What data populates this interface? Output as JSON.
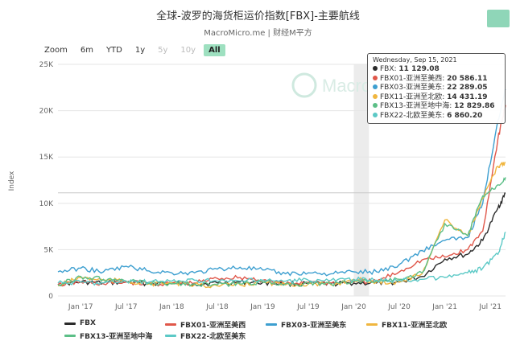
{
  "header": {
    "title": "全球-波罗的海货柜运价指数[FBX]-主要航线",
    "subtitle": "MacroMicro.me | 财经M平方"
  },
  "zoom": {
    "label": "Zoom",
    "buttons": [
      {
        "label": "6m",
        "state": "normal"
      },
      {
        "label": "YTD",
        "state": "normal"
      },
      {
        "label": "1y",
        "state": "normal"
      },
      {
        "label": "5y",
        "state": "disabled"
      },
      {
        "label": "10y",
        "state": "disabled"
      },
      {
        "label": "All",
        "state": "active"
      }
    ]
  },
  "watermark": "MacroM",
  "tooltip": {
    "date": "Wednesday, Sep 15, 2021",
    "rows": [
      {
        "label": "FBX: ",
        "value": "11 129.08",
        "color": "#2b2b2b"
      },
      {
        "label": "FBX01-亚洲至美西: ",
        "value": "20 586.11",
        "color": "#e0574a"
      },
      {
        "label": "FBX03-亚洲至美东: ",
        "value": "22 289.05",
        "color": "#3d9fd0"
      },
      {
        "label": "FBX11-亚洲至北欧: ",
        "value": "14 431.19",
        "color": "#f0b63f"
      },
      {
        "label": "FBX13-亚洲至地中海: ",
        "value": "12 829.86",
        "color": "#5cbf87"
      },
      {
        "label": "FBX22-北欧至美东: ",
        "value": "6 860.20",
        "color": "#5cc9c6"
      }
    ]
  },
  "chart_data": {
    "type": "line",
    "ylabel": "Index",
    "ylim": [
      0,
      25000
    ],
    "yticks": [
      "0",
      "5K",
      "10K",
      "15K",
      "20K",
      "25K"
    ],
    "x_tick_labels": [
      "Jan '17",
      "Jul '17",
      "Jan '18",
      "Jul '18",
      "Jan '19",
      "Jul '19",
      "Jan '20",
      "Jul '20",
      "Jan '21",
      "Jul '21"
    ],
    "x_range": [
      "2016-10",
      "2021-09"
    ],
    "grid": true,
    "legend_position": "bottom",
    "plot_bands": [
      {
        "from": "2020-01",
        "to": "2020-03"
      }
    ],
    "plot_lines": [
      {
        "y": 11129.08
      }
    ],
    "series": [
      {
        "name": "FBX",
        "color": "#2b2b2b",
        "x": [
          "2016-10",
          "2017-01",
          "2017-04",
          "2017-07",
          "2017-10",
          "2018-01",
          "2018-04",
          "2018-07",
          "2018-10",
          "2019-01",
          "2019-04",
          "2019-07",
          "2019-10",
          "2020-01",
          "2020-04",
          "2020-07",
          "2020-10",
          "2021-01",
          "2021-04",
          "2021-06",
          "2021-08",
          "2021-09"
        ],
        "y": [
          1300,
          1500,
          1400,
          1500,
          1350,
          1400,
          1300,
          1400,
          1500,
          1450,
          1300,
          1350,
          1300,
          1400,
          1400,
          1500,
          2100,
          4000,
          4500,
          6000,
          9500,
          11100
        ]
      },
      {
        "name": "FBX01-亚洲至美西",
        "color": "#e0574a",
        "x": [
          "2016-10",
          "2017-01",
          "2017-04",
          "2017-07",
          "2017-10",
          "2018-01",
          "2018-04",
          "2018-07",
          "2018-10",
          "2019-01",
          "2019-04",
          "2019-07",
          "2019-10",
          "2020-01",
          "2020-04",
          "2020-07",
          "2020-10",
          "2021-01",
          "2021-04",
          "2021-06",
          "2021-08",
          "2021-09"
        ],
        "y": [
          1200,
          1500,
          1300,
          1500,
          1300,
          1300,
          1400,
          1900,
          2000,
          1700,
          1300,
          1500,
          1400,
          1500,
          1600,
          2600,
          3900,
          4200,
          5000,
          7000,
          17000,
          20600
        ]
      },
      {
        "name": "FBX03-亚洲至美东",
        "color": "#3d9fd0",
        "x": [
          "2016-10",
          "2017-01",
          "2017-04",
          "2017-07",
          "2017-10",
          "2018-01",
          "2018-04",
          "2018-07",
          "2018-10",
          "2019-01",
          "2019-04",
          "2019-07",
          "2019-10",
          "2020-01",
          "2020-04",
          "2020-07",
          "2020-10",
          "2021-01",
          "2021-04",
          "2021-06",
          "2021-08",
          "2021-09"
        ],
        "y": [
          2600,
          3000,
          2600,
          3200,
          2700,
          2500,
          2500,
          2900,
          3100,
          2800,
          2400,
          2500,
          2400,
          2600,
          2600,
          3400,
          4900,
          6000,
          6300,
          10000,
          19000,
          22300
        ]
      },
      {
        "name": "FBX11-亚洲至北欧",
        "color": "#f0b63f",
        "x": [
          "2016-10",
          "2017-01",
          "2017-04",
          "2017-07",
          "2017-10",
          "2018-01",
          "2018-04",
          "2018-07",
          "2018-10",
          "2019-01",
          "2019-04",
          "2019-07",
          "2019-10",
          "2020-01",
          "2020-04",
          "2020-07",
          "2020-10",
          "2021-01",
          "2021-04",
          "2021-06",
          "2021-08",
          "2021-09"
        ],
        "y": [
          1100,
          2000,
          1700,
          1600,
          1300,
          1400,
          1200,
          1100,
          1200,
          1500,
          1200,
          1300,
          1200,
          1800,
          1500,
          1500,
          2400,
          8200,
          6500,
          10500,
          14000,
          14400
        ]
      },
      {
        "name": "FBX13-亚洲至地中海",
        "color": "#5cbf87",
        "x": [
          "2016-10",
          "2017-01",
          "2017-04",
          "2017-07",
          "2017-10",
          "2018-01",
          "2018-04",
          "2018-07",
          "2018-10",
          "2019-01",
          "2019-04",
          "2019-07",
          "2019-10",
          "2020-01",
          "2020-04",
          "2020-07",
          "2020-10",
          "2021-01",
          "2021-04",
          "2021-06",
          "2021-08",
          "2021-09"
        ],
        "y": [
          1200,
          2100,
          1800,
          1600,
          1400,
          1300,
          1300,
          1200,
          1300,
          1500,
          1300,
          1300,
          1300,
          1600,
          1600,
          1800,
          2500,
          7800,
          6500,
          10800,
          12000,
          12800
        ]
      },
      {
        "name": "FBX22-北欧至美东",
        "color": "#5cc9c6",
        "x": [
          "2016-10",
          "2017-01",
          "2017-04",
          "2017-07",
          "2017-10",
          "2018-01",
          "2018-04",
          "2018-07",
          "2018-10",
          "2019-01",
          "2019-04",
          "2019-07",
          "2019-10",
          "2020-01",
          "2020-04",
          "2020-07",
          "2020-10",
          "2021-01",
          "2021-04",
          "2021-06",
          "2021-08",
          "2021-09"
        ],
        "y": [
          1400,
          1500,
          1400,
          1600,
          1500,
          1600,
          1700,
          1600,
          1600,
          1700,
          1600,
          1700,
          1700,
          1800,
          1700,
          1700,
          1800,
          2000,
          2500,
          3000,
          4500,
          6900
        ]
      }
    ]
  }
}
